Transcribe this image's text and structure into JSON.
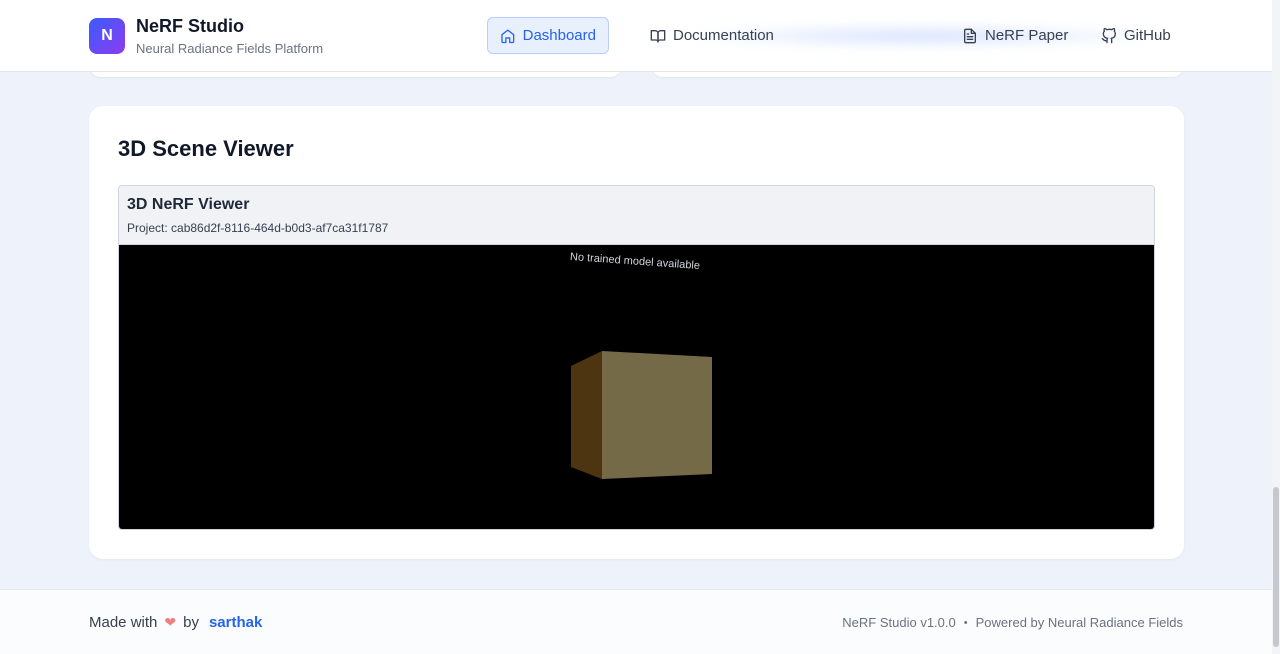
{
  "header": {
    "logo_letter": "N",
    "title": "NeRF Studio",
    "subtitle": "Neural Radiance Fields Platform",
    "nav": [
      {
        "label": "Dashboard",
        "icon": "home-icon",
        "active": true
      },
      {
        "label": "Documentation",
        "icon": "book-icon",
        "active": false
      },
      {
        "label": "NeRF Paper",
        "icon": "document-icon",
        "active": false
      },
      {
        "label": "GitHub",
        "icon": "github-icon",
        "active": false
      }
    ]
  },
  "viewer_card": {
    "title": "3D Scene Viewer",
    "viewer_title": "3D NeRF Viewer",
    "project_label": "Project: cab86d2f-8116-464d-b0d3-af7ca31f1787",
    "canvas_message": "No trained model available"
  },
  "footer": {
    "made_with": "Made with",
    "heart": "❤",
    "by": "by",
    "author": "sarthak",
    "version": "NeRF Studio v1.0.0",
    "separator": "•",
    "powered": "Powered by Neural Radiance Fields"
  },
  "colors": {
    "accent": "#2563eb",
    "logo_gradient_start": "#3b5bfd",
    "logo_gradient_end": "#8b3cf0",
    "cube_front": "#756a48",
    "cube_side": "#4e3512",
    "heart": "#f08080"
  }
}
